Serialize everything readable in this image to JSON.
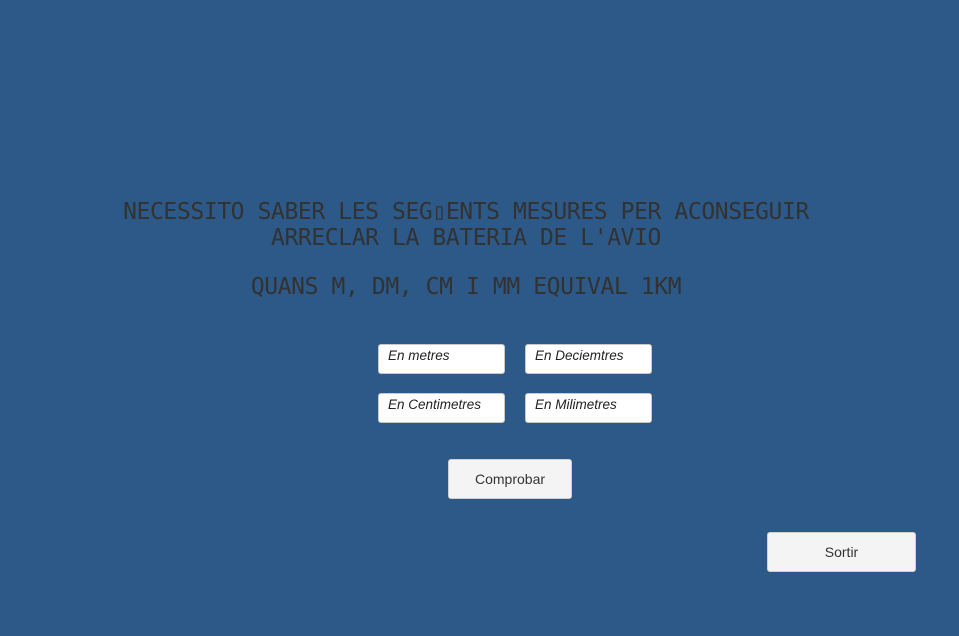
{
  "prompt": {
    "line1": "NECESSITO SABER LES SEG▯ENTS MESURES PER ACONSEGUIR",
    "line2": "ARRECLAR LA BATERIA DE L'AVIO",
    "question": "QUANS M, DM, CM I MM EQUIVAL 1KM"
  },
  "inputs": {
    "metres": {
      "placeholder": "En metres",
      "value": ""
    },
    "decimetres": {
      "placeholder": "En Deciemtres",
      "value": ""
    },
    "centimetres": {
      "placeholder": "En Centimetres",
      "value": ""
    },
    "milimetres": {
      "placeholder": "En Milimetres",
      "value": ""
    }
  },
  "buttons": {
    "check": "Comprobar",
    "exit": "Sortir"
  }
}
